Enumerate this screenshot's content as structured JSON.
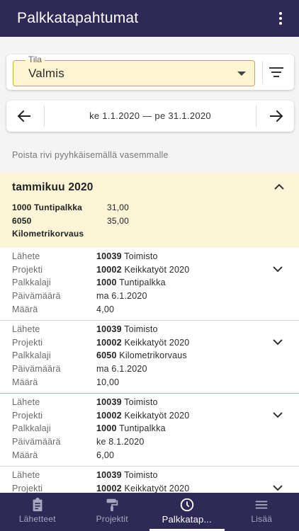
{
  "appbar": {
    "title": "Palkkatapahtumat",
    "menu_icon": "more-vert-icon"
  },
  "filter": {
    "label": "Tila",
    "value": "Valmis",
    "filter_icon": "filter-list-icon"
  },
  "date_range": {
    "text": "ke 1.1.2020 — pe 31.1.2020",
    "prev_icon": "arrow-left-icon",
    "next_icon": "arrow-right-icon"
  },
  "hint": "Poista rivi pyyhkäisemällä vasemmalle",
  "month": {
    "title": "tammikuu 2020",
    "summary": [
      {
        "code": "1000",
        "name": "Tuntipalkka",
        "value": "31,00"
      },
      {
        "code": "6050",
        "name": "Kilometrikorvaus",
        "value": "35,00"
      }
    ]
  },
  "labels": {
    "lahete": "Lähete",
    "projekti": "Projekti",
    "palkkalaji": "Palkkalaji",
    "paivamaara": "Päivämäärä",
    "maara": "Määrä"
  },
  "items": [
    {
      "lahete_code": "10039",
      "lahete_name": "Toimisto",
      "projekti_code": "10002",
      "projekti_name": "Keikkatyöt 2020",
      "palkkalaji_code": "1000",
      "palkkalaji_name": "Tuntipalkka",
      "paivamaara": "ma 6.1.2020",
      "maara": "4,00"
    },
    {
      "lahete_code": "10039",
      "lahete_name": "Toimisto",
      "projekti_code": "10002",
      "projekti_name": "Keikkatyöt 2020",
      "palkkalaji_code": "6050",
      "palkkalaji_name": "Kilometrikorvaus",
      "paivamaara": "ma 6.1.2020",
      "maara": "10,00"
    },
    {
      "lahete_code": "10039",
      "lahete_name": "Toimisto",
      "projekti_code": "10002",
      "projekti_name": "Keikkatyöt 2020",
      "palkkalaji_code": "1000",
      "palkkalaji_name": "Tuntipalkka",
      "paivamaara": "ke 8.1.2020",
      "maara": "6,00"
    },
    {
      "lahete_code": "10039",
      "lahete_name": "Toimisto",
      "projekti_code": "10002",
      "projekti_name": "Keikkatyöt 2020",
      "palkkalaji_code": "",
      "palkkalaji_name": "",
      "paivamaara": "",
      "maara": ""
    }
  ],
  "nav": [
    {
      "label": "Lähetteet",
      "icon": "clipboard-icon"
    },
    {
      "label": "Projektit",
      "icon": "paint-roller-icon"
    },
    {
      "label": "Palkkatap...",
      "icon": "clock-icon",
      "active": true
    },
    {
      "label": "Lisää",
      "icon": "menu-icon"
    }
  ],
  "colors": {
    "primary": "#2e2a55",
    "highlight": "#fcf4d6",
    "select_fill": "#fdf5d2",
    "select_border": "#c9a94a"
  }
}
